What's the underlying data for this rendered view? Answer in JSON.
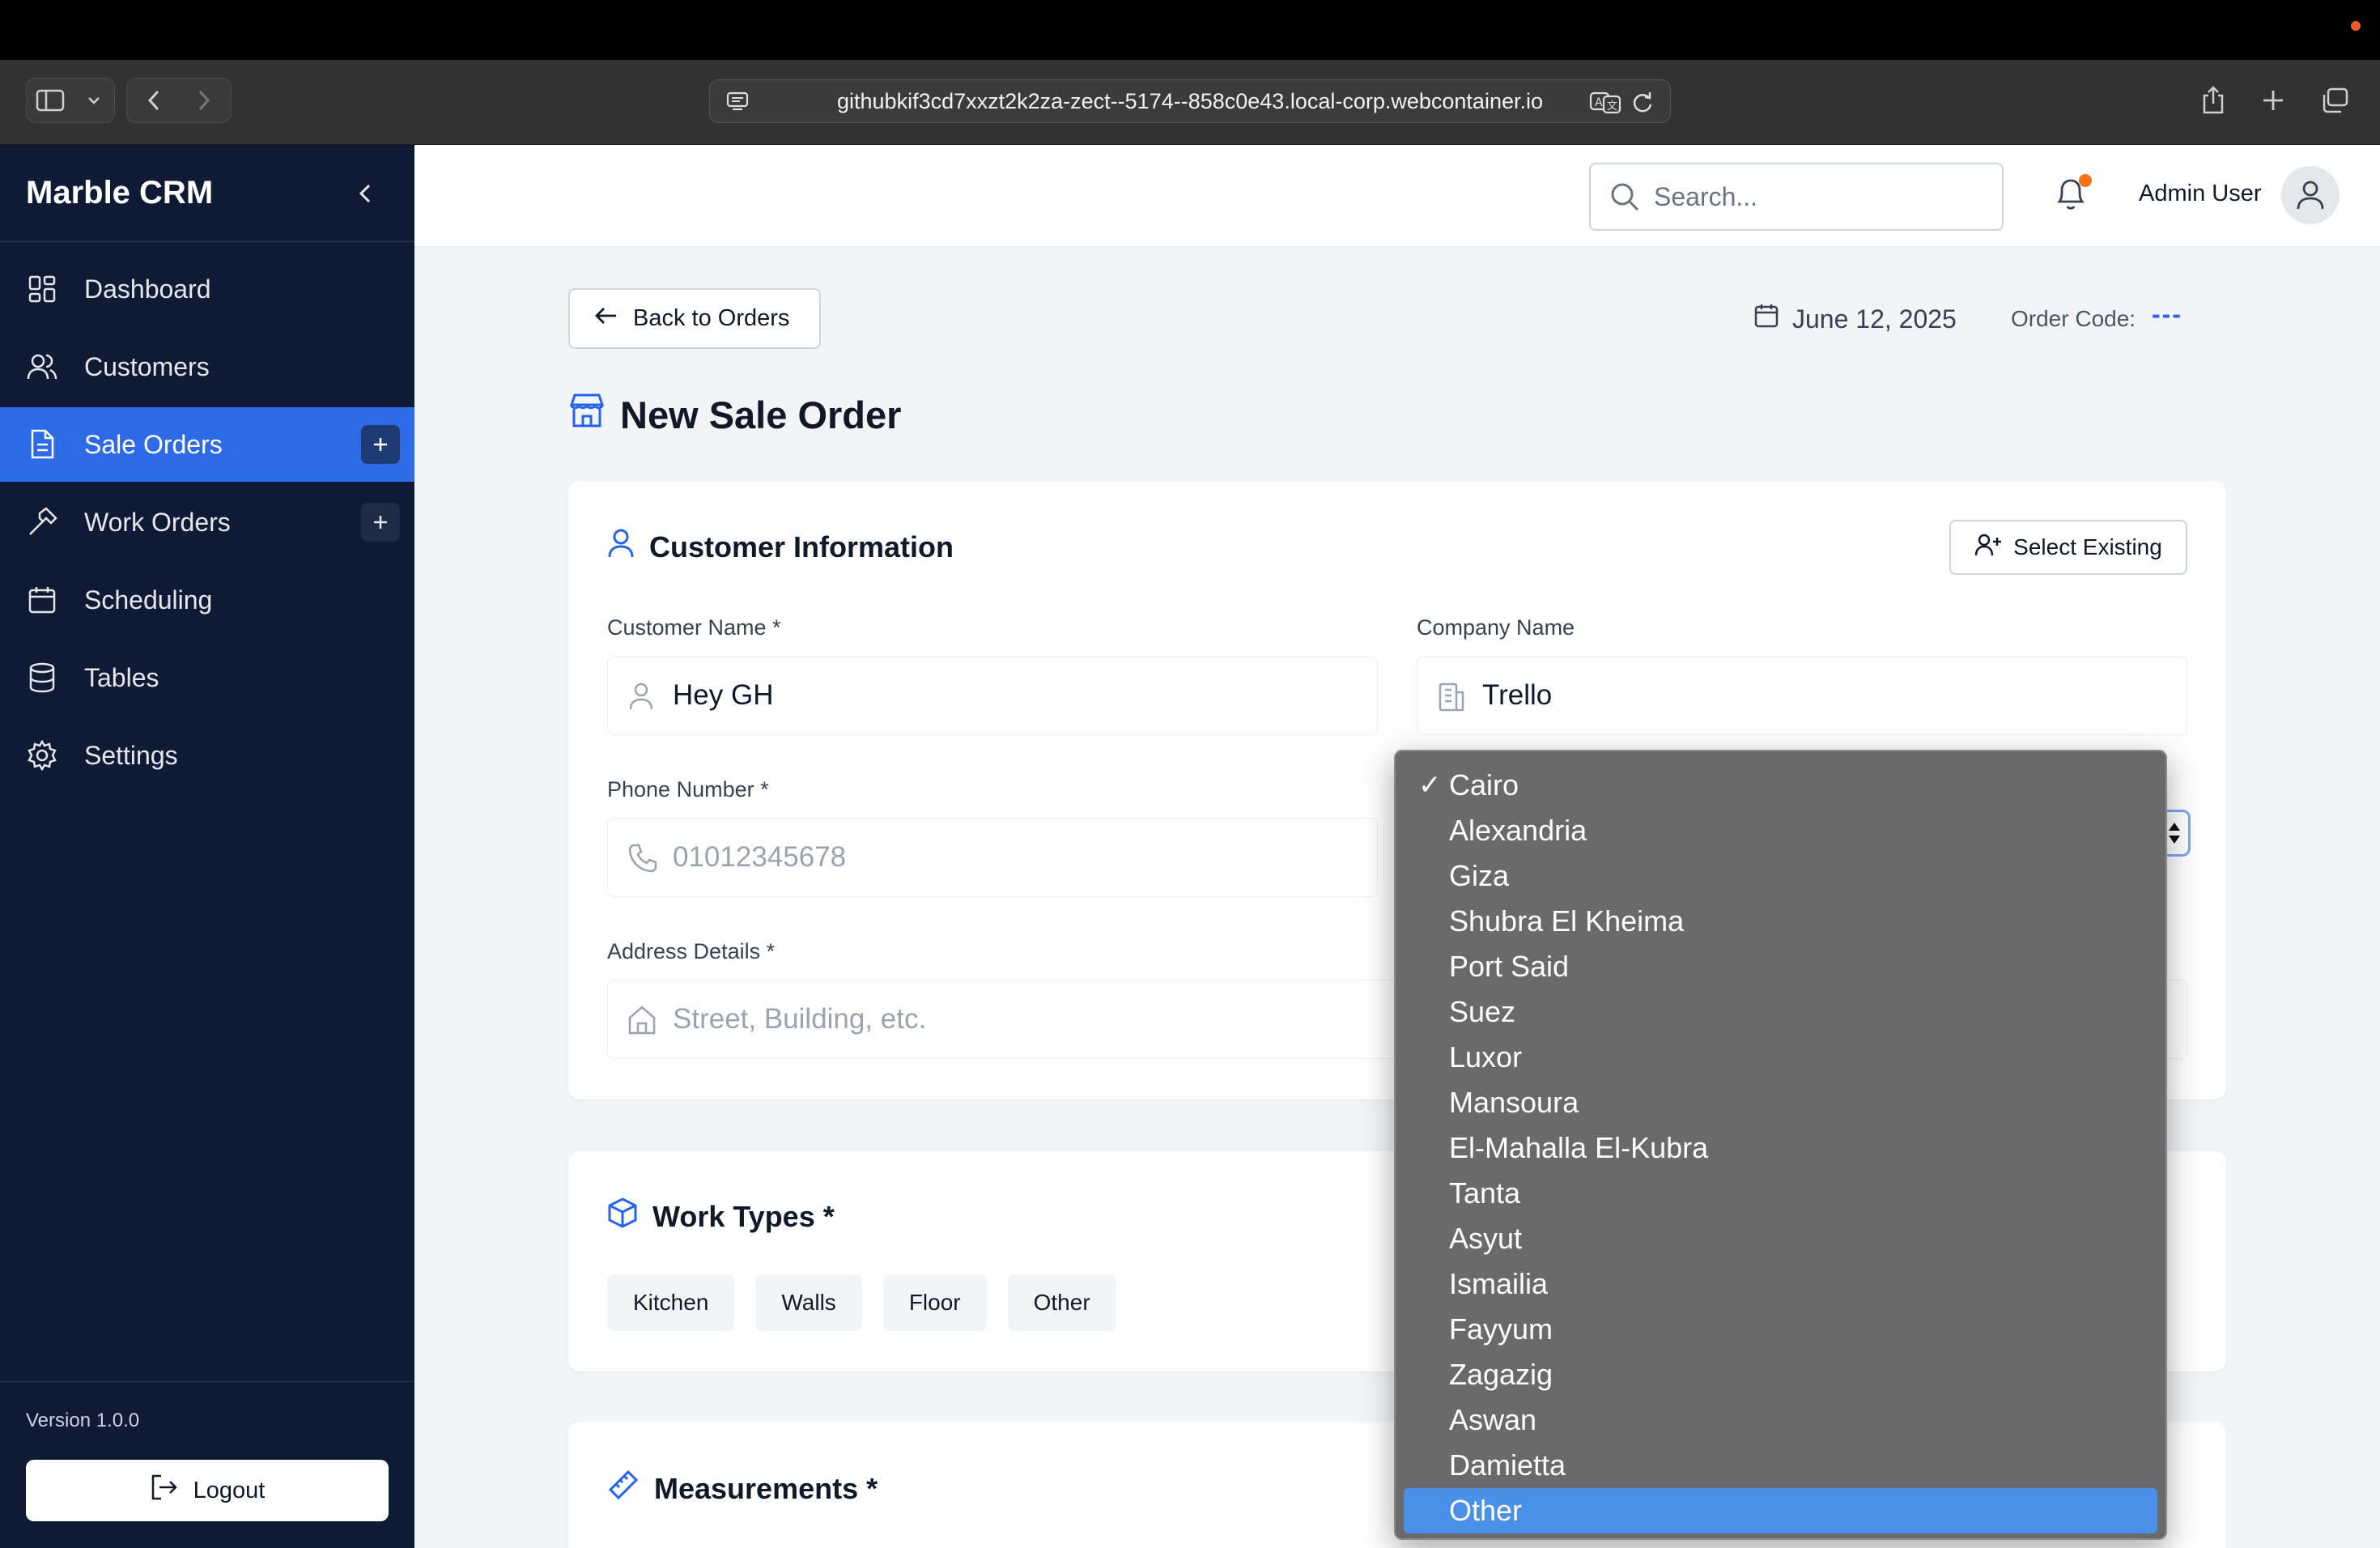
{
  "browser": {
    "url": "githubkif3cd7xxzt2k2za-zect--5174--858c0e43.local-corp.webcontainer.io"
  },
  "sidebar": {
    "brand": "Marble CRM",
    "items": [
      {
        "label": "Dashboard",
        "icon": "dashboard-icon"
      },
      {
        "label": "Customers",
        "icon": "users-icon"
      },
      {
        "label": "Sale Orders",
        "icon": "document-icon",
        "active": true
      },
      {
        "label": "Work Orders",
        "icon": "hammer-icon"
      },
      {
        "label": "Scheduling",
        "icon": "calendar-icon"
      },
      {
        "label": "Tables",
        "icon": "database-icon"
      },
      {
        "label": "Settings",
        "icon": "gear-icon"
      }
    ],
    "version": "Version 1.0.0",
    "logout": "Logout"
  },
  "header": {
    "search_placeholder": "Search...",
    "user": "Admin User"
  },
  "page": {
    "back": "Back to Orders",
    "date": "June 12, 2025",
    "order_code_label": "Order Code:",
    "order_code_value": "---",
    "title": "New Sale Order"
  },
  "customer": {
    "title": "Customer Information",
    "select_existing": "Select Existing",
    "name_label": "Customer Name *",
    "name_value": "Hey GH",
    "company_label": "Company Name",
    "company_value": "Trello",
    "phone_label": "Phone Number *",
    "phone_placeholder": "01012345678",
    "address_label": "Address Details *",
    "address_placeholder": "Street, Building, etc."
  },
  "work_types": {
    "title": "Work Types *",
    "options": [
      "Kitchen",
      "Walls",
      "Floor",
      "Other"
    ]
  },
  "measurements": {
    "title": "Measurements *"
  },
  "city_dropdown": {
    "selected": "Cairo",
    "highlighted": "Other",
    "options": [
      "Cairo",
      "Alexandria",
      "Giza",
      "Shubra El Kheima",
      "Port Said",
      "Suez",
      "Luxor",
      "Mansoura",
      "El-Mahalla El-Kubra",
      "Tanta",
      "Asyut",
      "Ismailia",
      "Fayyum",
      "Zagazig",
      "Aswan",
      "Damietta",
      "Other"
    ]
  },
  "colors": {
    "sidebar_bg": "#0f1b35",
    "accent": "#2f6ae6",
    "notification": "#f97316"
  }
}
